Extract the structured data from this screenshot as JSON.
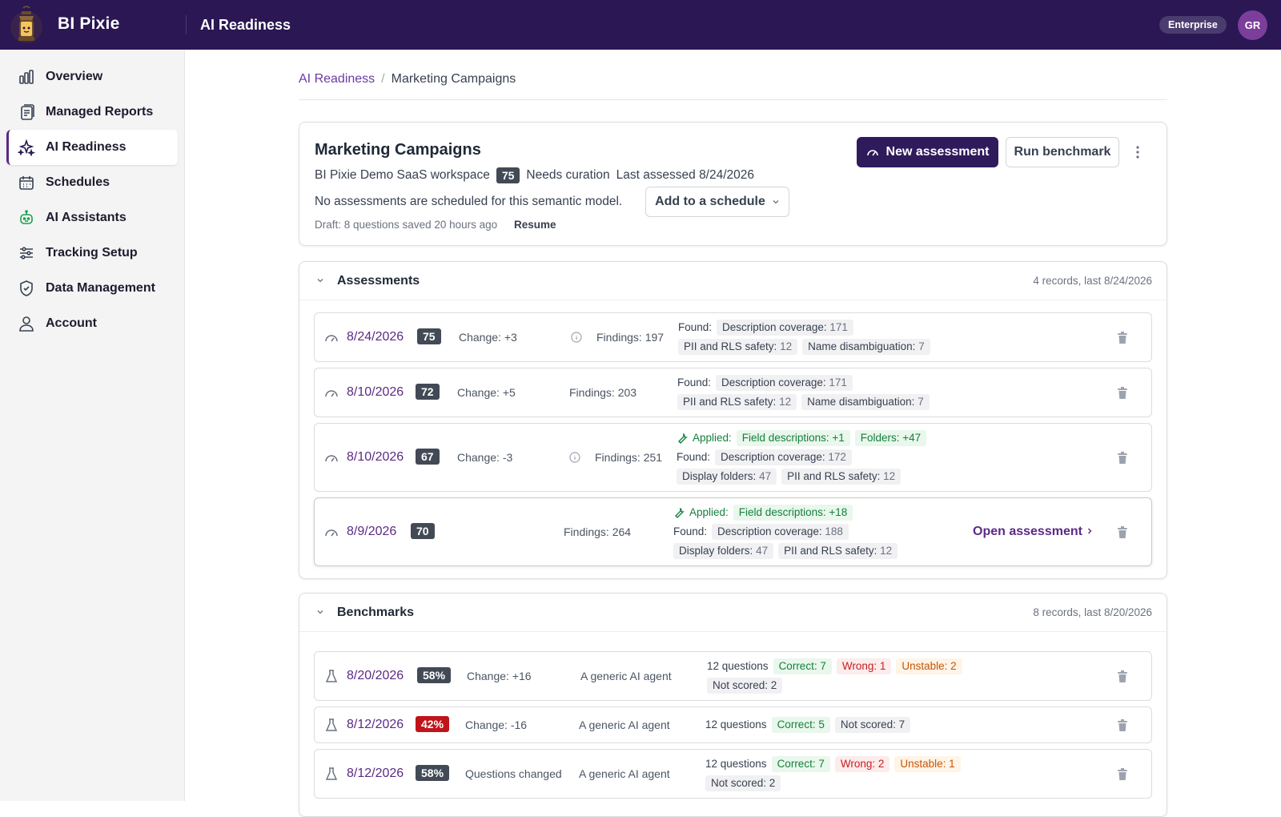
{
  "header": {
    "brand": "BI Pixie",
    "page_title": "AI Readiness",
    "plan_badge": "Enterprise",
    "avatar_initials": "GR"
  },
  "sidebar": {
    "items": [
      {
        "label": "Overview",
        "icon": "bar-chart-icon",
        "active": false
      },
      {
        "label": "Managed Reports",
        "icon": "report-stack-icon",
        "active": false
      },
      {
        "label": "AI Readiness",
        "icon": "sparkle-icon",
        "active": true
      },
      {
        "label": "Schedules",
        "icon": "calendar-icon",
        "active": false
      },
      {
        "label": "AI Assistants",
        "icon": "robot-icon",
        "active": false
      },
      {
        "label": "Tracking Setup",
        "icon": "sliders-icon",
        "active": false
      },
      {
        "label": "Data Management",
        "icon": "shield-icon",
        "active": false
      },
      {
        "label": "Account",
        "icon": "user-icon",
        "active": false
      }
    ]
  },
  "breadcrumb": {
    "parent": "AI Readiness",
    "current": "Marketing Campaigns"
  },
  "model": {
    "title": "Marketing Campaigns",
    "workspace": "BI Pixie Demo SaaS workspace",
    "score": "75",
    "status": "Needs curation",
    "last_assessed": "Last assessed 8/24/2026",
    "schedule_text": "No assessments are scheduled for this semantic model.",
    "add_schedule_label": "Add to a schedule",
    "draft_text": "Draft: 8 questions saved 20 hours ago",
    "resume_label": "Resume",
    "new_assessment_label": "New assessment",
    "run_benchmark_label": "Run benchmark"
  },
  "assessments": {
    "title": "Assessments",
    "summary": "4 records, last 8/24/2026",
    "rows": [
      {
        "date": "8/24/2026",
        "score": "75",
        "change": "Change: +3",
        "findings": "Findings: 197",
        "found_label": "Found:",
        "found": [
          {
            "k": "Description coverage:",
            "v": "171"
          },
          {
            "k": "PII and RLS safety:",
            "v": "12"
          },
          {
            "k": "Name disambiguation:",
            "v": "7"
          }
        ]
      },
      {
        "date": "8/10/2026",
        "score": "72",
        "change": "Change: +5",
        "findings": "Findings: 203",
        "found_label": "Found:",
        "found": [
          {
            "k": "Description coverage:",
            "v": "171"
          },
          {
            "k": "PII and RLS safety:",
            "v": "12"
          },
          {
            "k": "Name disambiguation:",
            "v": "7"
          }
        ]
      },
      {
        "date": "8/10/2026",
        "score": "67",
        "change": "Change: -3",
        "findings": "Findings: 251",
        "applied_label": "Applied:",
        "applied": [
          "Field descriptions: +1",
          "Folders: +47"
        ],
        "found_label": "Found:",
        "found": [
          {
            "k": "Description coverage:",
            "v": "172"
          },
          {
            "k": "Display folders:",
            "v": "47"
          },
          {
            "k": "PII and RLS safety:",
            "v": "12"
          }
        ]
      },
      {
        "date": "8/9/2026",
        "score": "70",
        "findings": "Findings: 264",
        "applied_label": "Applied:",
        "applied": [
          "Field descriptions: +18"
        ],
        "found_label": "Found:",
        "found": [
          {
            "k": "Description coverage:",
            "v": "188"
          },
          {
            "k": "Display folders:",
            "v": "47"
          },
          {
            "k": "PII and RLS safety:",
            "v": "12"
          }
        ],
        "open_label": "Open assessment"
      }
    ]
  },
  "benchmarks": {
    "title": "Benchmarks",
    "summary": "8 records, last 8/20/2026",
    "rows": [
      {
        "date": "8/20/2026",
        "score": "58%",
        "change": "Change: +16",
        "agent": "A generic AI agent",
        "questions": "12 questions",
        "correct": "Correct: 7",
        "wrong": "Wrong: 1",
        "unstable": "Unstable: 2",
        "not_scored_label": "Not scored:",
        "not_scored": "2"
      },
      {
        "date": "8/12/2026",
        "score": "42%",
        "change": "Change: -16",
        "agent": "A generic AI agent",
        "questions": "12 questions",
        "correct": "Correct: 5",
        "not_scored_label": "Not scored:",
        "not_scored": "7"
      },
      {
        "date": "8/12/2026",
        "score": "58%",
        "change": "Questions changed",
        "agent": "A generic AI agent",
        "questions": "12 questions",
        "correct": "Correct: 7",
        "wrong": "Wrong: 2",
        "unstable": "Unstable: 1",
        "not_scored_label": "Not scored:",
        "not_scored": "2"
      }
    ]
  },
  "colors": {
    "topbar": "#2a1753",
    "accent": "#5b2a86",
    "primary_button": "#2f1a5c",
    "badge_gray": "#424a56",
    "badge_red": "#c0141b"
  }
}
